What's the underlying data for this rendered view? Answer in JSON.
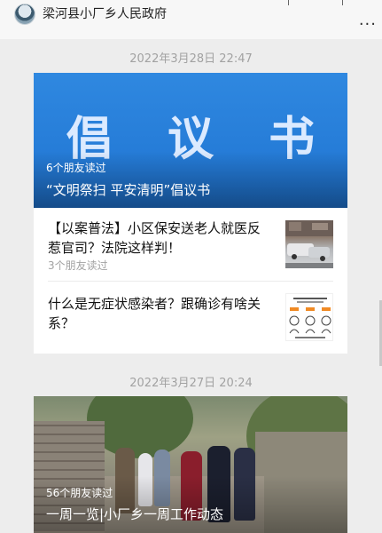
{
  "account": {
    "name": "梁河县小厂乡人民政府"
  },
  "toolbar": {
    "more_label": "..."
  },
  "feed": [
    {
      "timestamp": "2022年3月28日  22:47",
      "main": {
        "cover_text": "倡 议 书",
        "reads": "6个朋友读过",
        "title": "“文明祭扫 平安清明”倡议书"
      },
      "items": [
        {
          "title": "【以案普法】小区保安送老人就医反惹官司？法院这样判！",
          "reads": "3个朋友读过",
          "thumb_icon": "photo-thumbnail"
        },
        {
          "title": "什么是无症状感染者？跟确诊有啥关系？",
          "reads": "",
          "thumb_icon": "diagram-thumbnail"
        }
      ]
    },
    {
      "timestamp": "2022年3月27日  20:24",
      "main": {
        "reads": "56个朋友读过",
        "title": "一周一览|小厂乡一周工作动态"
      }
    }
  ]
}
